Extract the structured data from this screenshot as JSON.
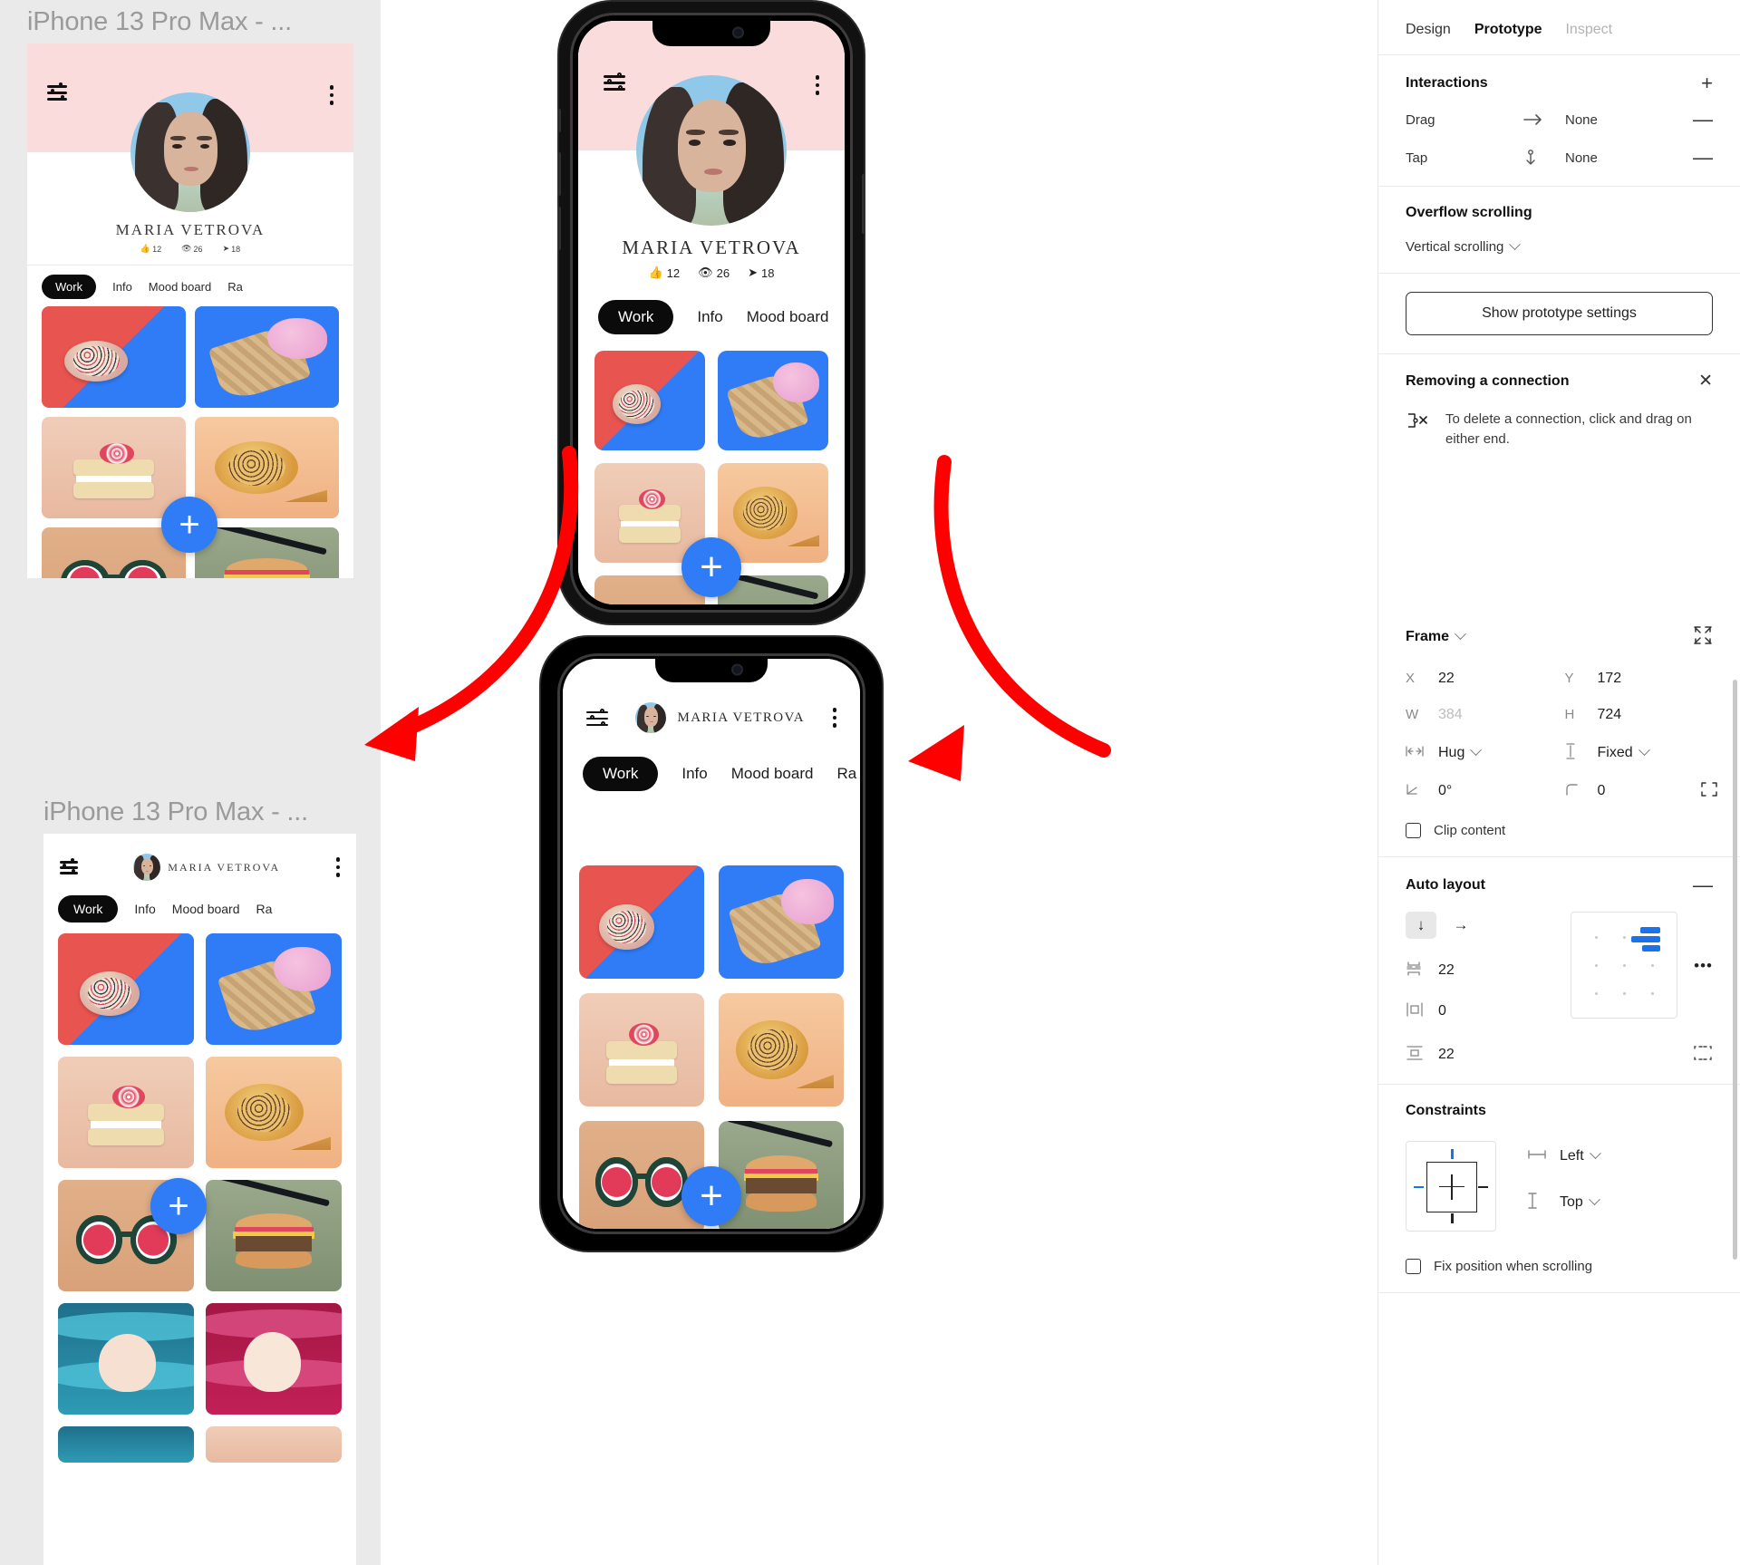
{
  "canvas": {
    "frames": [
      {
        "label": "iPhone 13 Pro Max - ..."
      },
      {
        "label": "iPhone 13 Pro Max - ..."
      }
    ]
  },
  "app": {
    "profile_name": "MARIA VETROVA",
    "stats": [
      {
        "icon": "thumbs-up-icon",
        "value": "12"
      },
      {
        "icon": "eye-icon",
        "value": "26"
      },
      {
        "icon": "share-icon",
        "value": "18"
      }
    ],
    "tabs": [
      {
        "label": "Work",
        "active": true
      },
      {
        "label": "Info",
        "active": false
      },
      {
        "label": "Mood board",
        "active": false
      },
      {
        "label": "Ra",
        "active": false
      }
    ],
    "fab_label": "+",
    "icons": {
      "filter": "sliders-icon",
      "menu": "kebab-menu-icon"
    },
    "gallery": [
      {
        "name": "berry-tart-on-red-blue"
      },
      {
        "name": "ice-cream-cone-on-blue"
      },
      {
        "name": "layered-cake-slice"
      },
      {
        "name": "cheese-tart-slices"
      },
      {
        "name": "watermelon-glasses"
      },
      {
        "name": "mini-burger-with-chopsticks"
      },
      {
        "name": "paper-art-blue-woman"
      },
      {
        "name": "paper-art-red-woman"
      }
    ]
  },
  "panel": {
    "tabs": [
      {
        "label": "Design",
        "state": "normal"
      },
      {
        "label": "Prototype",
        "state": "active"
      },
      {
        "label": "Inspect",
        "state": "disabled"
      }
    ],
    "interactions": {
      "title": "Interactions",
      "add_label": "+",
      "rows": [
        {
          "trigger": "Drag",
          "icon": "arrow-right-icon",
          "target": "None",
          "remove_label": "—"
        },
        {
          "trigger": "Tap",
          "icon": "tap-anchor-icon",
          "target": "None",
          "remove_label": "—"
        }
      ]
    },
    "overflow": {
      "title": "Overflow scrolling",
      "value": "Vertical scrolling"
    },
    "prototype_settings_button": "Show prototype settings",
    "tip": {
      "title": "Removing a connection",
      "close_label": "✕",
      "icon": "remove-connection-icon",
      "body": "To delete a connection, click and drag on either end."
    },
    "frame": {
      "title": "Frame",
      "collapse_icon": "collapse-corners-icon",
      "fields": [
        {
          "label": "X",
          "value": "22",
          "dim": false
        },
        {
          "label": "Y",
          "value": "172",
          "dim": false
        },
        {
          "label": "W",
          "value": "384",
          "dim": true
        },
        {
          "label": "H",
          "value": "724",
          "dim": false
        }
      ],
      "resizing": [
        {
          "icon": "horizontal-resize-icon",
          "value": "Hug"
        },
        {
          "icon": "vertical-resize-icon",
          "value": "Fixed"
        }
      ],
      "rotation": {
        "icon": "angle-icon",
        "value": "0°"
      },
      "corner_radius": {
        "icon": "corner-radius-icon",
        "value": "0"
      },
      "independent_corners_icon": "independent-corners-icon",
      "clip_content": {
        "label": "Clip content",
        "checked": false
      }
    },
    "auto_layout": {
      "title": "Auto layout",
      "remove_label": "—",
      "direction": [
        {
          "icon": "arrow-down-icon",
          "selected": true
        },
        {
          "icon": "arrow-right-icon",
          "selected": false
        }
      ],
      "gap": {
        "icon": "gap-icon",
        "value": "22"
      },
      "padding_horizontal": {
        "icon": "horizontal-padding-icon",
        "value": "0"
      },
      "padding_vertical": {
        "icon": "vertical-padding-icon",
        "value": "22"
      },
      "more_label": "•••",
      "alignment": "top-right",
      "padding_sides_icon": "individual-padding-icon"
    },
    "constraints": {
      "title": "Constraints",
      "horizontal": {
        "icon": "horizontal-constraint-icon",
        "value": "Left"
      },
      "vertical": {
        "icon": "vertical-constraint-icon",
        "value": "Top"
      },
      "fix_position": {
        "label": "Fix position when scrolling",
        "checked": false
      }
    }
  },
  "colors": {
    "accent_blue": "#2f7cf6",
    "figma_blue": "#1a73e8",
    "pink_header": "#fbdcdc",
    "arrow_red": "#ff0000",
    "canvas_gray": "#eaeaea"
  }
}
